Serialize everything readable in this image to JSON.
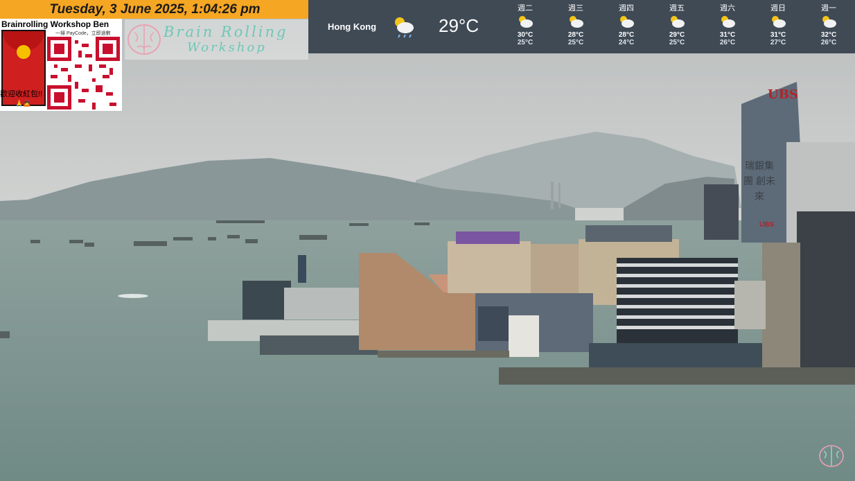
{
  "overlay": {
    "datetime": "Tuesday, 3 June 2025, 1:04:26 pm",
    "donation_title": "Brainrolling Workshop Ben",
    "donation_sub": "一掃 PayCode，立即過數",
    "donation_welcome": "歡迎收紅包!!",
    "donation_emoji": "🙏🙇",
    "brand_line1": "Brain Rolling",
    "brand_line2": "Workshop"
  },
  "weather": {
    "city": "Hong Kong",
    "current_temp": "29°C",
    "current_icon": "sun-cloud-rain-icon",
    "forecast": [
      {
        "day": "週二",
        "hi": "30°C",
        "lo": "25°C",
        "icon": "sun-cloud-icon"
      },
      {
        "day": "週三",
        "hi": "28°C",
        "lo": "25°C",
        "icon": "sun-cloud-icon"
      },
      {
        "day": "週四",
        "hi": "28°C",
        "lo": "24°C",
        "icon": "sun-cloud-icon"
      },
      {
        "day": "週五",
        "hi": "29°C",
        "lo": "25°C",
        "icon": "sun-cloud-icon"
      },
      {
        "day": "週六",
        "hi": "31°C",
        "lo": "26°C",
        "icon": "sun-cloud-icon"
      },
      {
        "day": "週日",
        "hi": "31°C",
        "lo": "27°C",
        "icon": "sun-cloud-icon"
      },
      {
        "day": "週一",
        "hi": "32°C",
        "lo": "26°C",
        "icon": "sun-cloud-icon"
      }
    ]
  },
  "scene": {
    "building_sign_latin": "UBS",
    "building_sign_cjk": "瑞銀集團 創未來",
    "building_sign_small": "UBS"
  },
  "colors": {
    "date_bar": "#f5a623",
    "weather_bar": "#3f4a55",
    "brand_teal": "#6fc7b5",
    "water": "#7f9691",
    "sky": "#c9cccb"
  }
}
